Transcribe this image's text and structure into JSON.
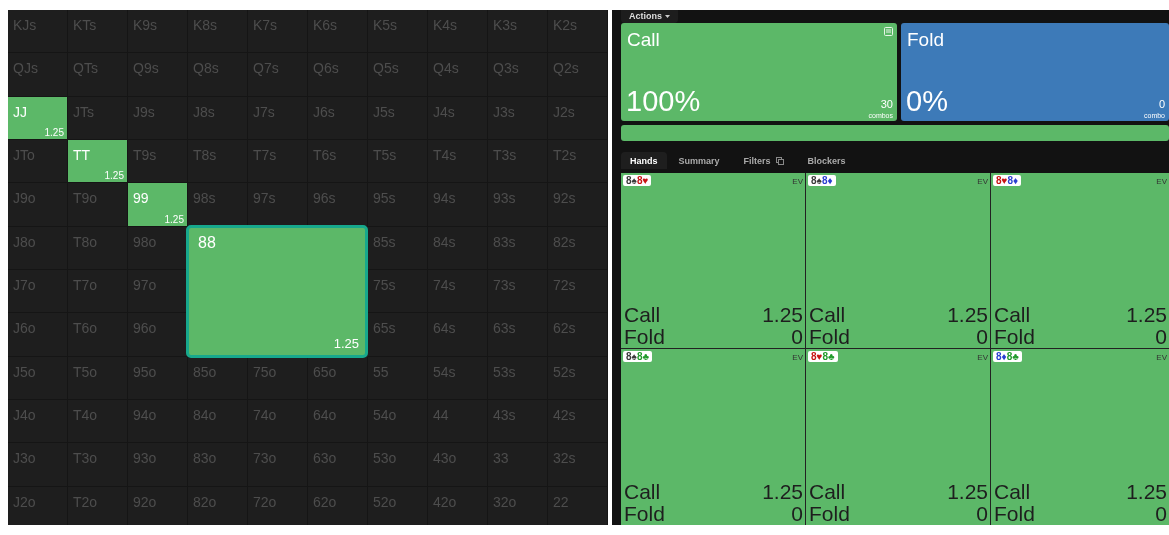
{
  "grid": {
    "rows": [
      {
        "cells": [
          {
            "label": "KJs",
            "in_range": false
          },
          {
            "label": "KTs",
            "in_range": false
          },
          {
            "label": "K9s",
            "in_range": false
          },
          {
            "label": "K8s",
            "in_range": false
          },
          {
            "label": "K7s",
            "in_range": false
          },
          {
            "label": "K6s",
            "in_range": false
          },
          {
            "label": "K5s",
            "in_range": false
          },
          {
            "label": "K4s",
            "in_range": false
          },
          {
            "label": "K3s",
            "in_range": false
          },
          {
            "label": "K2s",
            "in_range": false
          }
        ]
      },
      {
        "cells": [
          {
            "label": "QJs",
            "in_range": false
          },
          {
            "label": "QTs",
            "in_range": false
          },
          {
            "label": "Q9s",
            "in_range": false
          },
          {
            "label": "Q8s",
            "in_range": false
          },
          {
            "label": "Q7s",
            "in_range": false
          },
          {
            "label": "Q6s",
            "in_range": false
          },
          {
            "label": "Q5s",
            "in_range": false
          },
          {
            "label": "Q4s",
            "in_range": false
          },
          {
            "label": "Q3s",
            "in_range": false
          },
          {
            "label": "Q2s",
            "in_range": false
          }
        ]
      },
      {
        "cells": [
          {
            "label": "JJ",
            "in_range": true,
            "ev": "1.25"
          },
          {
            "label": "JTs",
            "in_range": false
          },
          {
            "label": "J9s",
            "in_range": false
          },
          {
            "label": "J8s",
            "in_range": false
          },
          {
            "label": "J7s",
            "in_range": false
          },
          {
            "label": "J6s",
            "in_range": false
          },
          {
            "label": "J5s",
            "in_range": false
          },
          {
            "label": "J4s",
            "in_range": false
          },
          {
            "label": "J3s",
            "in_range": false
          },
          {
            "label": "J2s",
            "in_range": false
          }
        ]
      },
      {
        "cells": [
          {
            "label": "JTo",
            "in_range": false
          },
          {
            "label": "TT",
            "in_range": true,
            "ev": "1.25"
          },
          {
            "label": "T9s",
            "in_range": false
          },
          {
            "label": "T8s",
            "in_range": false
          },
          {
            "label": "T7s",
            "in_range": false
          },
          {
            "label": "T6s",
            "in_range": false
          },
          {
            "label": "T5s",
            "in_range": false
          },
          {
            "label": "T4s",
            "in_range": false
          },
          {
            "label": "T3s",
            "in_range": false
          },
          {
            "label": "T2s",
            "in_range": false
          }
        ]
      },
      {
        "cells": [
          {
            "label": "J9o",
            "in_range": false
          },
          {
            "label": "T9o",
            "in_range": false
          },
          {
            "label": "99",
            "in_range": true,
            "ev": "1.25"
          },
          {
            "label": "98s",
            "in_range": false
          },
          {
            "label": "97s",
            "in_range": false
          },
          {
            "label": "96s",
            "in_range": false
          },
          {
            "label": "95s",
            "in_range": false
          },
          {
            "label": "94s",
            "in_range": false
          },
          {
            "label": "93s",
            "in_range": false
          },
          {
            "label": "92s",
            "in_range": false
          }
        ]
      },
      {
        "cells": [
          {
            "label": "J8o",
            "in_range": false
          },
          {
            "label": "T8o",
            "in_range": false
          },
          {
            "label": "98o",
            "in_range": false
          },
          {
            "kind": "zoomed",
            "label": "88",
            "ev": "1.25",
            "colspan": 3,
            "rowspan": 3
          },
          {
            "label": "85s",
            "in_range": false
          },
          {
            "label": "84s",
            "in_range": false
          },
          {
            "label": "83s",
            "in_range": false
          },
          {
            "label": "82s",
            "in_range": false
          }
        ]
      },
      {
        "cells": [
          {
            "label": "J7o",
            "in_range": false
          },
          {
            "label": "T7o",
            "in_range": false
          },
          {
            "label": "97o",
            "in_range": false
          },
          {
            "label": "75s",
            "in_range": false
          },
          {
            "label": "74s",
            "in_range": false
          },
          {
            "label": "73s",
            "in_range": false
          },
          {
            "label": "72s",
            "in_range": false
          }
        ]
      },
      {
        "cells": [
          {
            "label": "J6o",
            "in_range": false
          },
          {
            "label": "T6o",
            "in_range": false
          },
          {
            "label": "96o",
            "in_range": false
          },
          {
            "label": "65s",
            "in_range": false
          },
          {
            "label": "64s",
            "in_range": false
          },
          {
            "label": "63s",
            "in_range": false
          },
          {
            "label": "62s",
            "in_range": false
          }
        ]
      },
      {
        "cells": [
          {
            "label": "J5o",
            "in_range": false
          },
          {
            "label": "T5o",
            "in_range": false
          },
          {
            "label": "95o",
            "in_range": false
          },
          {
            "label": "85o",
            "in_range": false
          },
          {
            "label": "75o",
            "in_range": false
          },
          {
            "label": "65o",
            "in_range": false
          },
          {
            "label": "55",
            "in_range": false
          },
          {
            "label": "54s",
            "in_range": false
          },
          {
            "label": "53s",
            "in_range": false
          },
          {
            "label": "52s",
            "in_range": false
          }
        ]
      },
      {
        "cells": [
          {
            "label": "J4o",
            "in_range": false
          },
          {
            "label": "T4o",
            "in_range": false
          },
          {
            "label": "94o",
            "in_range": false
          },
          {
            "label": "84o",
            "in_range": false
          },
          {
            "label": "74o",
            "in_range": false
          },
          {
            "label": "64o",
            "in_range": false
          },
          {
            "label": "54o",
            "in_range": false
          },
          {
            "label": "44",
            "in_range": false
          },
          {
            "label": "43s",
            "in_range": false
          },
          {
            "label": "42s",
            "in_range": false
          }
        ]
      },
      {
        "cells": [
          {
            "label": "J3o",
            "in_range": false
          },
          {
            "label": "T3o",
            "in_range": false
          },
          {
            "label": "93o",
            "in_range": false
          },
          {
            "label": "83o",
            "in_range": false
          },
          {
            "label": "73o",
            "in_range": false
          },
          {
            "label": "63o",
            "in_range": false
          },
          {
            "label": "53o",
            "in_range": false
          },
          {
            "label": "43o",
            "in_range": false
          },
          {
            "label": "33",
            "in_range": false
          },
          {
            "label": "32s",
            "in_range": false
          }
        ]
      },
      {
        "cells": [
          {
            "label": "J2o",
            "in_range": false
          },
          {
            "label": "T2o",
            "in_range": false
          },
          {
            "label": "92o",
            "in_range": false
          },
          {
            "label": "82o",
            "in_range": false
          },
          {
            "label": "72o",
            "in_range": false
          },
          {
            "label": "62o",
            "in_range": false
          },
          {
            "label": "52o",
            "in_range": false
          },
          {
            "label": "42o",
            "in_range": false
          },
          {
            "label": "32o",
            "in_range": false
          },
          {
            "label": "22",
            "in_range": false
          }
        ]
      }
    ]
  },
  "actions_tab": {
    "label": "Actions"
  },
  "actions": [
    {
      "kind": "call",
      "label": "Call",
      "percent": "100%",
      "combos": "30",
      "combos_label": "combos",
      "color": "#5cb868",
      "menu_icon": true
    },
    {
      "kind": "fold",
      "label": "Fold",
      "percent": "0%",
      "combos": "0",
      "combos_label": "combo",
      "color": "#3d7ab8",
      "menu_icon": false
    }
  ],
  "frequency_bar": {
    "level": 1,
    "color": "#5cb868"
  },
  "tabs": [
    {
      "label": "Hands",
      "selected": true,
      "icon": false
    },
    {
      "label": "Summary",
      "selected": false,
      "icon": false
    },
    {
      "label": "Filters",
      "selected": false,
      "icon": true
    },
    {
      "label": "Blockers",
      "selected": false,
      "icon": false
    }
  ],
  "hands": [
    {
      "cards": [
        {
          "rank": "8",
          "suit": "♠",
          "color": "#3a3a3a"
        },
        {
          "rank": "8",
          "suit": "♥",
          "color": "#c81414"
        }
      ],
      "ev_label": "EV",
      "rows": [
        {
          "action": "Call",
          "value": "1.25"
        },
        {
          "action": "Fold",
          "value": "0"
        }
      ]
    },
    {
      "cards": [
        {
          "rank": "8",
          "suit": "♠",
          "color": "#3a3a3a"
        },
        {
          "rank": "8",
          "suit": "♦",
          "color": "#2a3fd0"
        }
      ],
      "ev_label": "EV",
      "rows": [
        {
          "action": "Call",
          "value": "1.25"
        },
        {
          "action": "Fold",
          "value": "0"
        }
      ]
    },
    {
      "cards": [
        {
          "rank": "8",
          "suit": "♥",
          "color": "#c81414"
        },
        {
          "rank": "8",
          "suit": "♦",
          "color": "#2a3fd0"
        }
      ],
      "ev_label": "EV",
      "rows": [
        {
          "action": "Call",
          "value": "1.25"
        },
        {
          "action": "Fold",
          "value": "0"
        }
      ]
    },
    {
      "cards": [
        {
          "rank": "8",
          "suit": "♠",
          "color": "#3a3a3a"
        },
        {
          "rank": "8",
          "suit": "♣",
          "color": "#1f9a2a"
        }
      ],
      "ev_label": "EV",
      "rows": [
        {
          "action": "Call",
          "value": "1.25"
        },
        {
          "action": "Fold",
          "value": "0"
        }
      ]
    },
    {
      "cards": [
        {
          "rank": "8",
          "suit": "♥",
          "color": "#c81414"
        },
        {
          "rank": "8",
          "suit": "♣",
          "color": "#1f9a2a"
        }
      ],
      "ev_label": "EV",
      "rows": [
        {
          "action": "Call",
          "value": "1.25"
        },
        {
          "action": "Fold",
          "value": "0"
        }
      ]
    },
    {
      "cards": [
        {
          "rank": "8",
          "suit": "♦",
          "color": "#2a3fd0"
        },
        {
          "rank": "8",
          "suit": "♣",
          "color": "#1f9a2a"
        }
      ],
      "ev_label": "EV",
      "rows": [
        {
          "action": "Call",
          "value": "1.25"
        },
        {
          "action": "Fold",
          "value": "0"
        }
      ]
    }
  ]
}
